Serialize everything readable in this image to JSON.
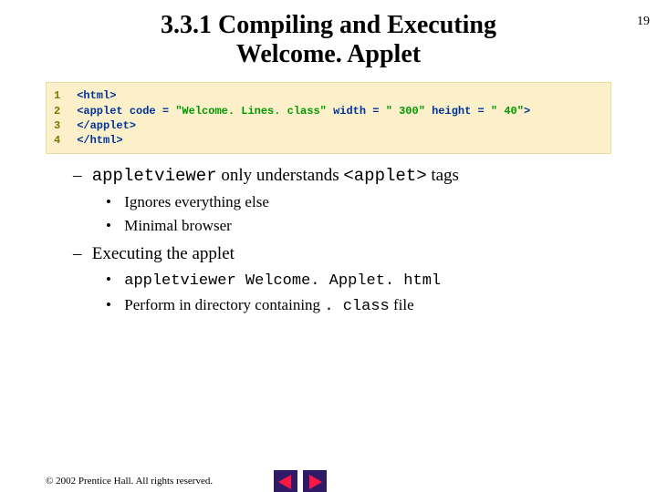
{
  "page_number": "19",
  "title_line1": "3.3.1  Compiling and Executing",
  "title_line2": "Welcome. Applet",
  "code": {
    "l1": {
      "n": "1",
      "tag1": "<html>"
    },
    "l2": {
      "n": "2",
      "open": "<applet",
      "a1": " code = ",
      "v1": "\"Welcome. Lines. class\"",
      "a2": " width = ",
      "v2": "\" 300\"",
      "a3": " height = ",
      "v3": "\" 40\"",
      "close": ">"
    },
    "l3": {
      "n": "3",
      "tag1": "</applet>"
    },
    "l4": {
      "n": "4",
      "tag1": "</html>"
    }
  },
  "b1": {
    "pre": "appletviewer",
    "mid": " only understands ",
    "post": "<applet>",
    "tail": " tags"
  },
  "b1a": "Ignores everything else",
  "b1b": "Minimal browser",
  "b2": "Executing the applet",
  "b2a": "appletviewer Welcome. Applet. html",
  "b2b_pre": "Perform in directory containing ",
  "b2b_mono": ". class",
  "b2b_post": " file",
  "footer": "© 2002 Prentice Hall.  All rights reserved."
}
